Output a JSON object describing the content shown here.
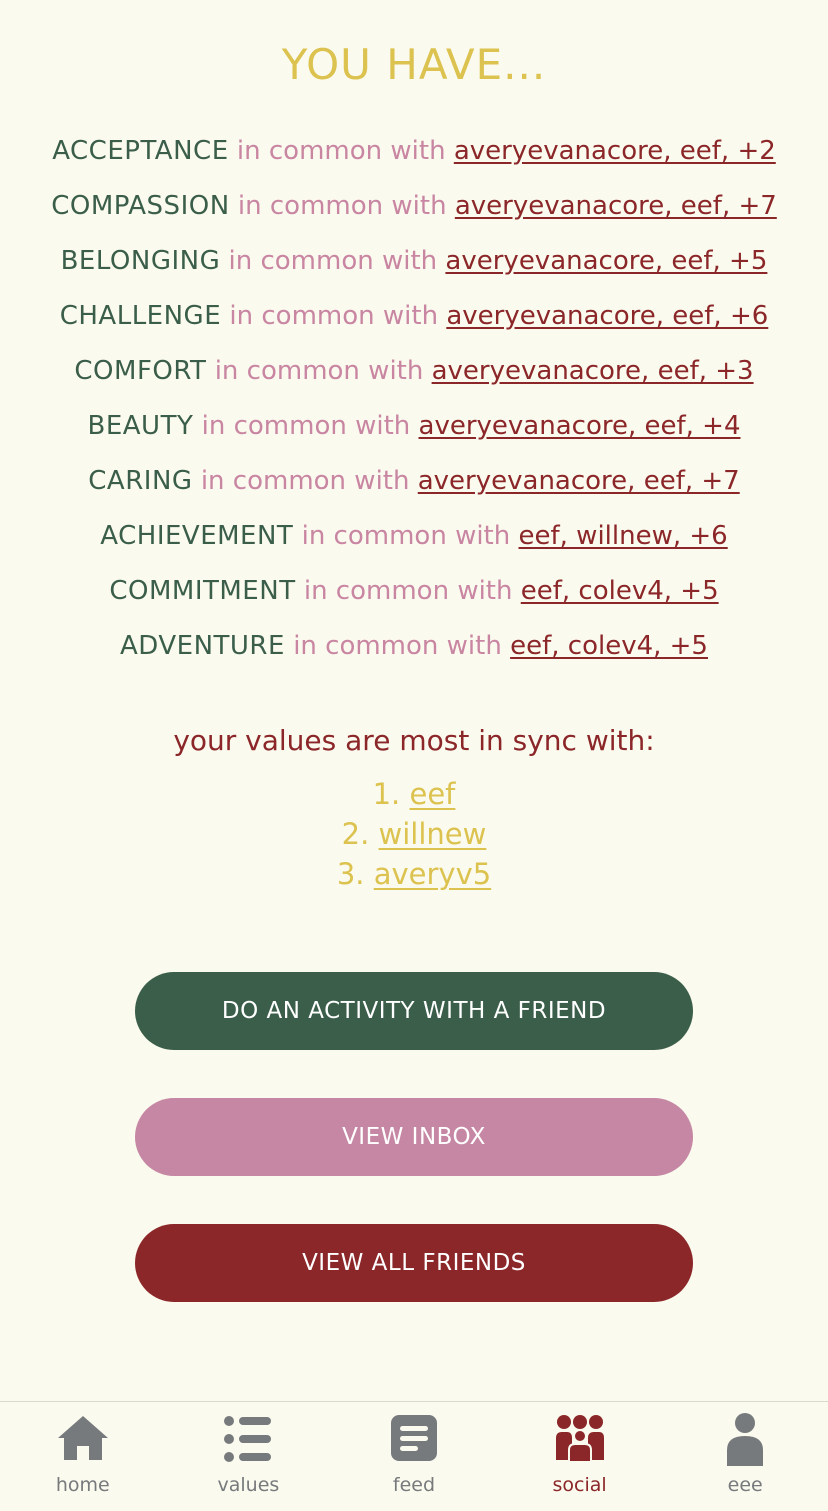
{
  "header": {
    "title": "YOU HAVE..."
  },
  "common_values": [
    {
      "value": "ACCEPTANCE",
      "text": "in common with",
      "friends": "averyevanacore, eef, +2"
    },
    {
      "value": "COMPASSION",
      "text": "in common with",
      "friends": "averyevanacore, eef, +7"
    },
    {
      "value": "BELONGING",
      "text": "in common with",
      "friends": "averyevanacore, eef, +5"
    },
    {
      "value": "CHALLENGE",
      "text": "in common with",
      "friends": "averyevanacore, eef, +6"
    },
    {
      "value": "COMFORT",
      "text": "in common with",
      "friends": "averyevanacore, eef, +3"
    },
    {
      "value": "BEAUTY",
      "text": "in common with",
      "friends": "averyevanacore, eef, +4"
    },
    {
      "value": "CARING",
      "text": "in common with",
      "friends": "averyevanacore, eef, +7"
    },
    {
      "value": "ACHIEVEMENT",
      "text": "in common with",
      "friends": "eef, willnew, +6"
    },
    {
      "value": "COMMITMENT",
      "text": "in common with",
      "friends": "eef, colev4, +5"
    },
    {
      "value": "ADVENTURE",
      "text": "in common with",
      "friends": "eef, colev4, +5"
    }
  ],
  "sync": {
    "heading": "your values are most in sync with:",
    "items": [
      {
        "rank": "1.",
        "name": "eef"
      },
      {
        "rank": "2.",
        "name": "willnew"
      },
      {
        "rank": "3.",
        "name": "averyv5"
      }
    ]
  },
  "buttons": {
    "activity": "DO AN ACTIVITY WITH A FRIEND",
    "inbox": "VIEW INBOX",
    "friends": "VIEW ALL FRIENDS"
  },
  "nav": {
    "items": [
      {
        "label": "home",
        "icon": "home-icon",
        "active": false
      },
      {
        "label": "values",
        "icon": "list-icon",
        "active": false
      },
      {
        "label": "feed",
        "icon": "feed-icon",
        "active": false
      },
      {
        "label": "social",
        "icon": "group-icon",
        "active": true
      },
      {
        "label": "eee",
        "icon": "person-icon",
        "active": false
      }
    ]
  },
  "colors": {
    "background": "#fbfaee",
    "gold": "#dcc24f",
    "green": "#3a5e4a",
    "pink": "#c587a3",
    "red": "#8b2629",
    "nav_gray": "#777a7d"
  }
}
